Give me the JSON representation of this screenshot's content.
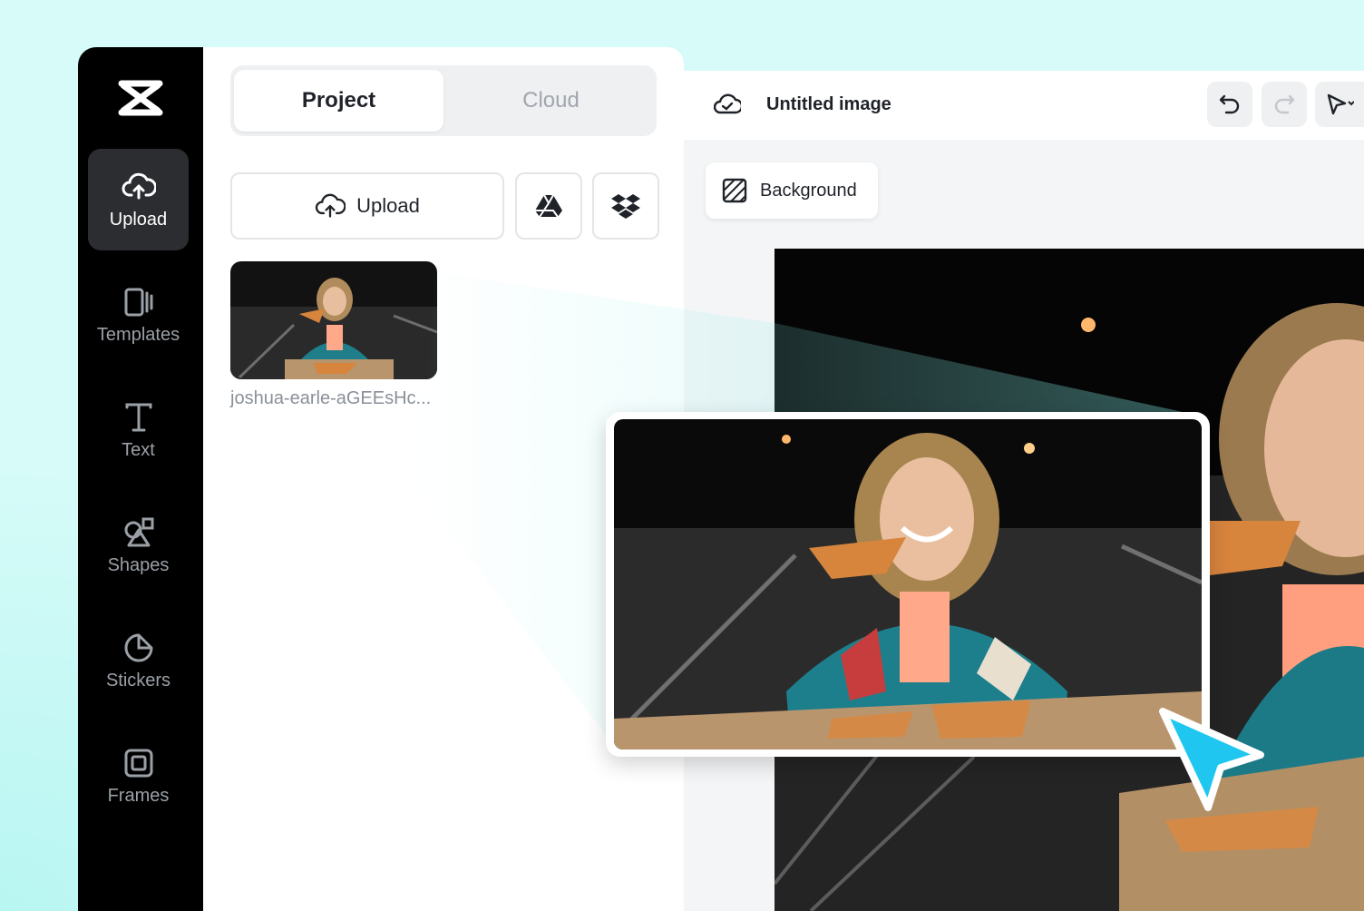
{
  "sidebar": {
    "items": [
      {
        "label": "Upload",
        "icon": "cloud-upload-icon",
        "active": true
      },
      {
        "label": "Templates",
        "icon": "templates-icon"
      },
      {
        "label": "Text",
        "icon": "text-icon"
      },
      {
        "label": "Shapes",
        "icon": "shapes-icon"
      },
      {
        "label": "Stickers",
        "icon": "sticker-icon"
      },
      {
        "label": "Frames",
        "icon": "frame-icon"
      }
    ]
  },
  "panel": {
    "tabs": [
      {
        "label": "Project",
        "selected": true
      },
      {
        "label": "Cloud"
      }
    ],
    "upload_label": "Upload",
    "media": [
      {
        "filename": "joshua-earle-aGEEsHc..."
      }
    ]
  },
  "editor": {
    "title": "Untitled image",
    "background_label": "Background"
  },
  "colors": {
    "accent_cursor": "#1fc7f0",
    "page_bg": "#d6fbf8",
    "sidebar_bg": "#000000"
  }
}
